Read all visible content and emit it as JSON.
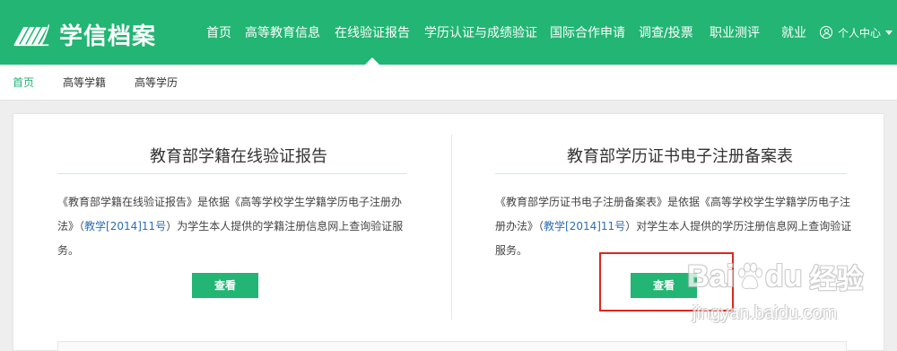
{
  "header": {
    "logo_text": "学信档案",
    "nav": [
      {
        "label": "首页"
      },
      {
        "label": "高等教育信息"
      },
      {
        "label": "在线验证报告"
      },
      {
        "label": "学历认证与成绩验证"
      },
      {
        "label": "国际合作申请"
      },
      {
        "label": "调查/投票"
      },
      {
        "label": "职业测评"
      },
      {
        "label": "就业"
      }
    ],
    "user_menu": "个人中心"
  },
  "subnav": [
    {
      "label": "首页"
    },
    {
      "label": "高等学籍"
    },
    {
      "label": "高等学历"
    }
  ],
  "cards": [
    {
      "title": "教育部学籍在线验证报告",
      "desc_line1": "《教育部学籍在线验证报告》是依据《高等学校学生学籍学历电子注册办",
      "desc_line2_a": "法》（",
      "desc_line2_link": "教学[2014]11号",
      "desc_line2_b": "）为学生本人提供的学籍注册信息网上查询验证服",
      "desc_line3": "务。",
      "button": "查看"
    },
    {
      "title": "教育部学历证书电子注册备案表",
      "desc_line1": "《教育部学历证书电子注册备案表》是依据《高等学校学生学籍学历电子注",
      "desc_line2_a": "册办法》（",
      "desc_line2_link": "教学[2014]11号",
      "desc_line2_b": "）对学生本人提供的学历注册信息网上查询验证",
      "desc_line3": "服务。",
      "button": "查看"
    }
  ],
  "watermark": {
    "brand_a": "Bai",
    "brand_b": "du",
    "brand_cn": "经验",
    "url": "jingyan.baidu.com"
  },
  "colors": {
    "brand_green": "#22b573",
    "link_blue": "#2d6db5",
    "highlight_red": "#e0261c"
  }
}
